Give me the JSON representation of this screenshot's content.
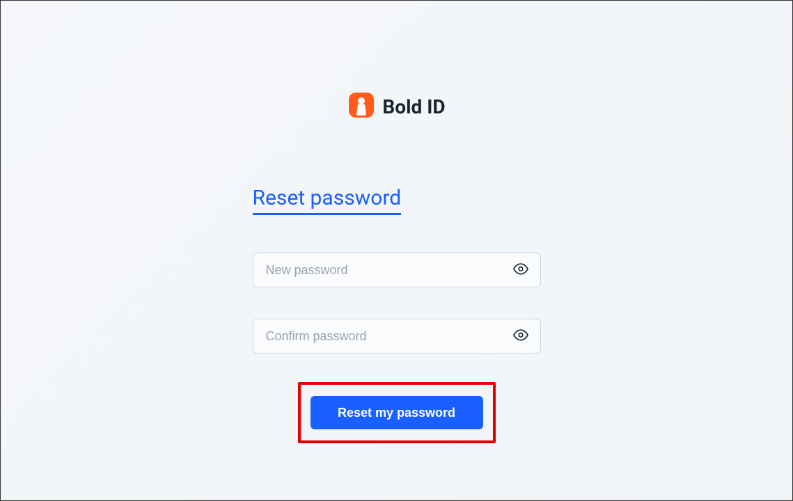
{
  "brand": {
    "name": "Bold ID",
    "accent_color": "#ff5c1a"
  },
  "form": {
    "heading": "Reset password",
    "new_password": {
      "placeholder": "New password",
      "value": ""
    },
    "confirm_password": {
      "placeholder": "Confirm password",
      "value": ""
    },
    "submit_label": "Reset my password"
  },
  "colors": {
    "primary_blue": "#1a5fff",
    "highlight_border": "#e60000"
  }
}
